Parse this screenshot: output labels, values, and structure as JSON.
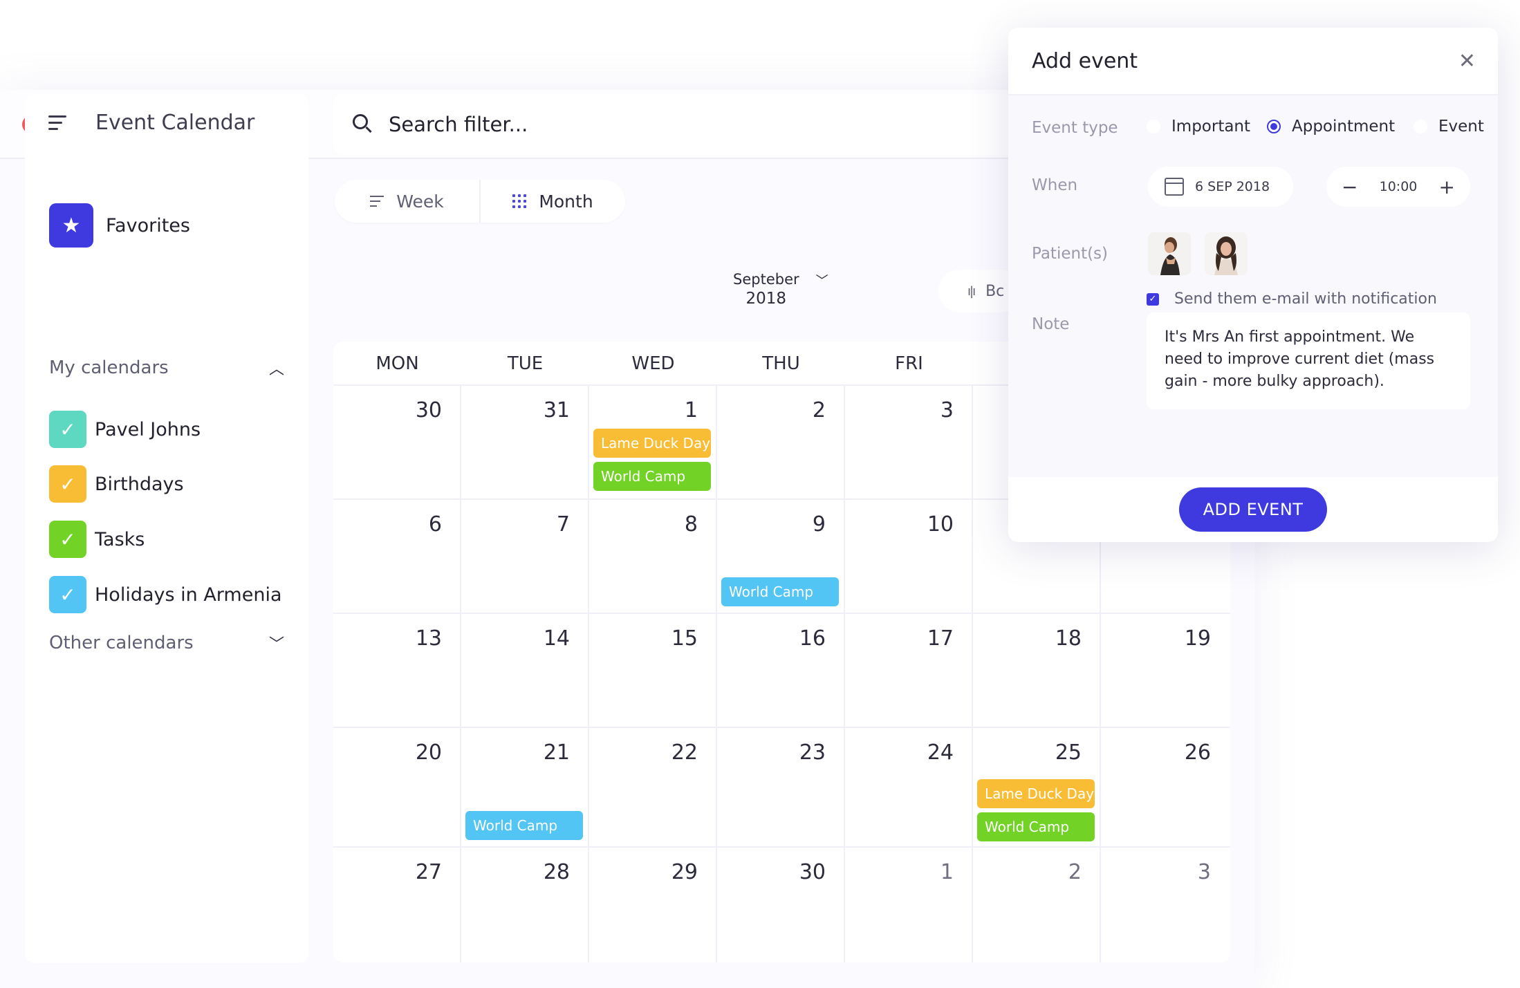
{
  "colors": {
    "accent": "#3e3ae0",
    "teal": "#5ed8c0",
    "yellow": "#f8bd35",
    "green": "#72d326",
    "blue": "#53c5f5"
  },
  "sidebar": {
    "title": "Event Calendar",
    "favorites_label": "Favorites",
    "my_calendars_label": "My calendars",
    "other_calendars_label": "Other calendars",
    "items": [
      {
        "label": "Pavel Johns"
      },
      {
        "label": "Birthdays"
      },
      {
        "label": "Tasks"
      },
      {
        "label": "Holidays in Armenia"
      }
    ]
  },
  "search": {
    "placeholder": "Search filter..."
  },
  "toolbar": {
    "week_label": "Week",
    "month_label": "Month",
    "month_name": "Septeber",
    "year": "2018",
    "board_label": "Bc"
  },
  "calendar": {
    "weekdays": [
      "MON",
      "TUE",
      "WED",
      "THU",
      "FRI",
      "",
      ""
    ],
    "weeks": [
      [
        "30",
        "31",
        "1",
        "2",
        "3",
        "",
        ""
      ],
      [
        "6",
        "7",
        "8",
        "9",
        "10",
        "",
        ""
      ],
      [
        "13",
        "14",
        "15",
        "16",
        "17",
        "18",
        "19"
      ],
      [
        "20",
        "21",
        "22",
        "23",
        "24",
        "25",
        "26"
      ],
      [
        "27",
        "28",
        "29",
        "30",
        "1",
        "2",
        "3"
      ]
    ],
    "events": {
      "lame_duck": "Lame Duck Day",
      "world_camp": "World Camp"
    }
  },
  "panel": {
    "title": "Add event",
    "event_type_label": "Event type",
    "type_options": [
      "Important",
      "Appointment",
      "Event"
    ],
    "selected_type": "Appointment",
    "when_label": "When",
    "date": "6 SEP 2018",
    "time": "10:00",
    "patients_label": "Patient(s)",
    "notify_text": "Send them e-mail with notification",
    "note_label": "Note",
    "note_text": "It's Mrs An first appointment. We need to improve current diet (mass gain -  more bulky approach).",
    "add_button": "ADD EVENT"
  }
}
